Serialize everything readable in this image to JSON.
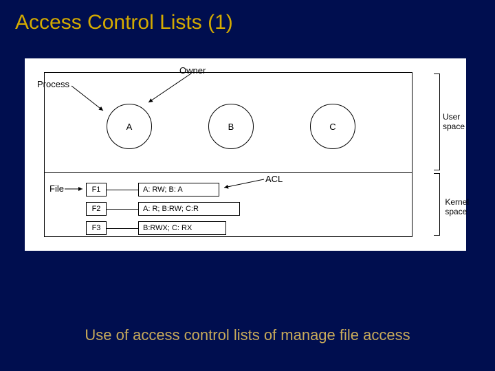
{
  "title": "Access Control Lists (1)",
  "caption": "Use of access control lists of manage file access",
  "labels": {
    "process": "Process",
    "owner": "Owner",
    "file": "File",
    "acl": "ACL",
    "user_space": "User\nspace",
    "kernel_space": "Kernel\nspace"
  },
  "processes": [
    "A",
    "B",
    "C"
  ],
  "files": [
    {
      "name": "F1",
      "acl": "A: RW;  B: A"
    },
    {
      "name": "F2",
      "acl": "A: R;   B:RW;   C:R"
    },
    {
      "name": "F3",
      "acl": "B:RWX;   C: RX"
    }
  ]
}
